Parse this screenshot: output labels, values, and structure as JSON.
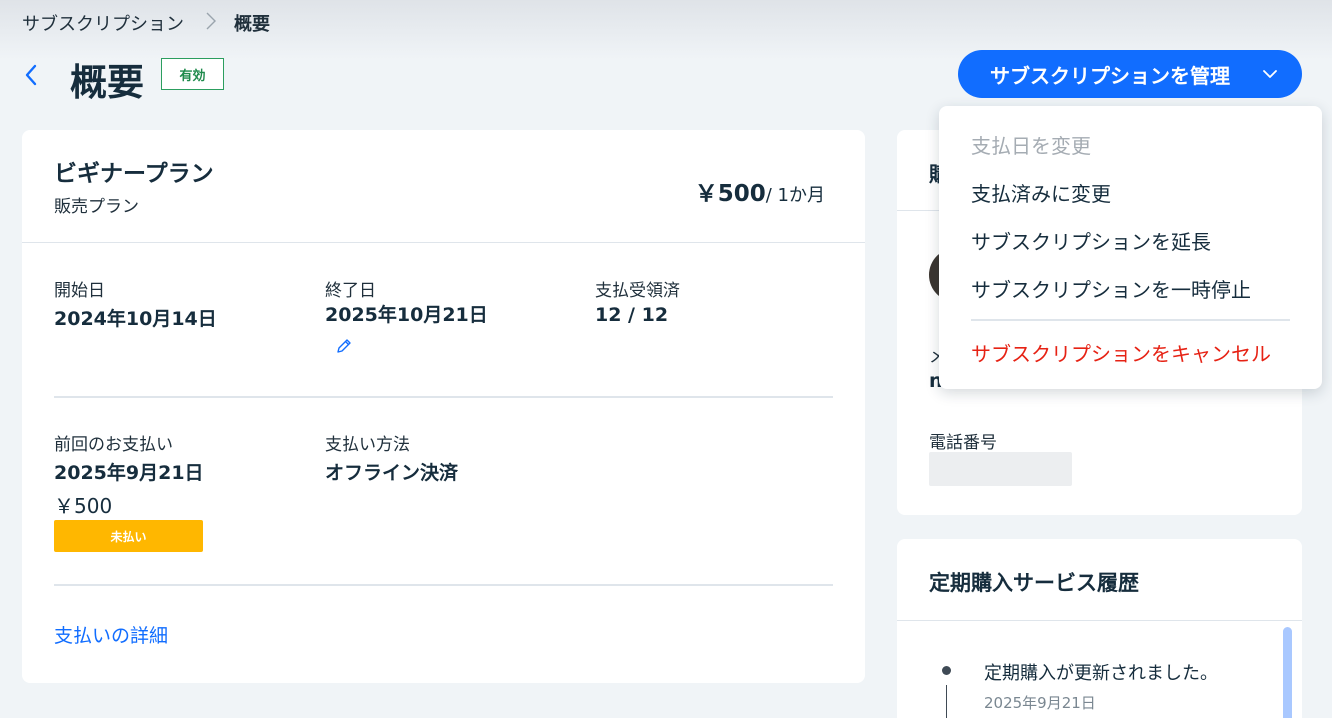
{
  "breadcrumb": {
    "parent": "サブスクリプション",
    "current": "概要"
  },
  "header": {
    "title": "概要",
    "status_badge": "有効",
    "manage_button": "サブスクリプションを管理"
  },
  "plan": {
    "name": "ビギナープラン",
    "type": "販売プラン",
    "price_amount": "￥500",
    "price_period": "/ 1か月"
  },
  "details": {
    "start_label": "開始日",
    "start_value": "2024年10月14日",
    "end_label": "終了日",
    "end_value": "2025年10月21日",
    "received_label": "支払受領済",
    "received_value": "12 / 12",
    "last_payment_label": "前回のお支払い",
    "last_payment_date": "2025年9月21日",
    "last_payment_amount": "￥500",
    "unpaid_badge": "未払い",
    "method_label": "支払い方法",
    "method_value": "オフライン決済",
    "payment_link": "支払いの詳細"
  },
  "customer": {
    "title_partial": "購",
    "email_label_partial": "メ",
    "email_value_partial": "n",
    "phone_label": "電話番号"
  },
  "history": {
    "title": "定期購入サービス履歴",
    "events": [
      {
        "text": "定期購入が更新されました。",
        "date": "2025年9月21日"
      }
    ]
  },
  "dropdown": {
    "items": [
      {
        "label": "支払日を変更",
        "state": "disabled"
      },
      {
        "label": "支払済みに変更",
        "state": "normal"
      },
      {
        "label": "サブスクリプションを延長",
        "state": "normal"
      },
      {
        "label": "サブスクリプションを一時停止",
        "state": "normal"
      },
      {
        "label": "サブスクリプションをキャンセル",
        "state": "danger"
      }
    ]
  },
  "colors": {
    "accent": "#116dff",
    "active_green": "#1f8a4c",
    "unpaid_yellow": "#ffb700",
    "danger_red": "#e62214"
  },
  "icons": {
    "back": "chevron-left-icon",
    "breadcrumb_sep": "chevron-right-icon",
    "manage_chevron": "chevron-down-icon",
    "edit": "pencil-icon"
  }
}
